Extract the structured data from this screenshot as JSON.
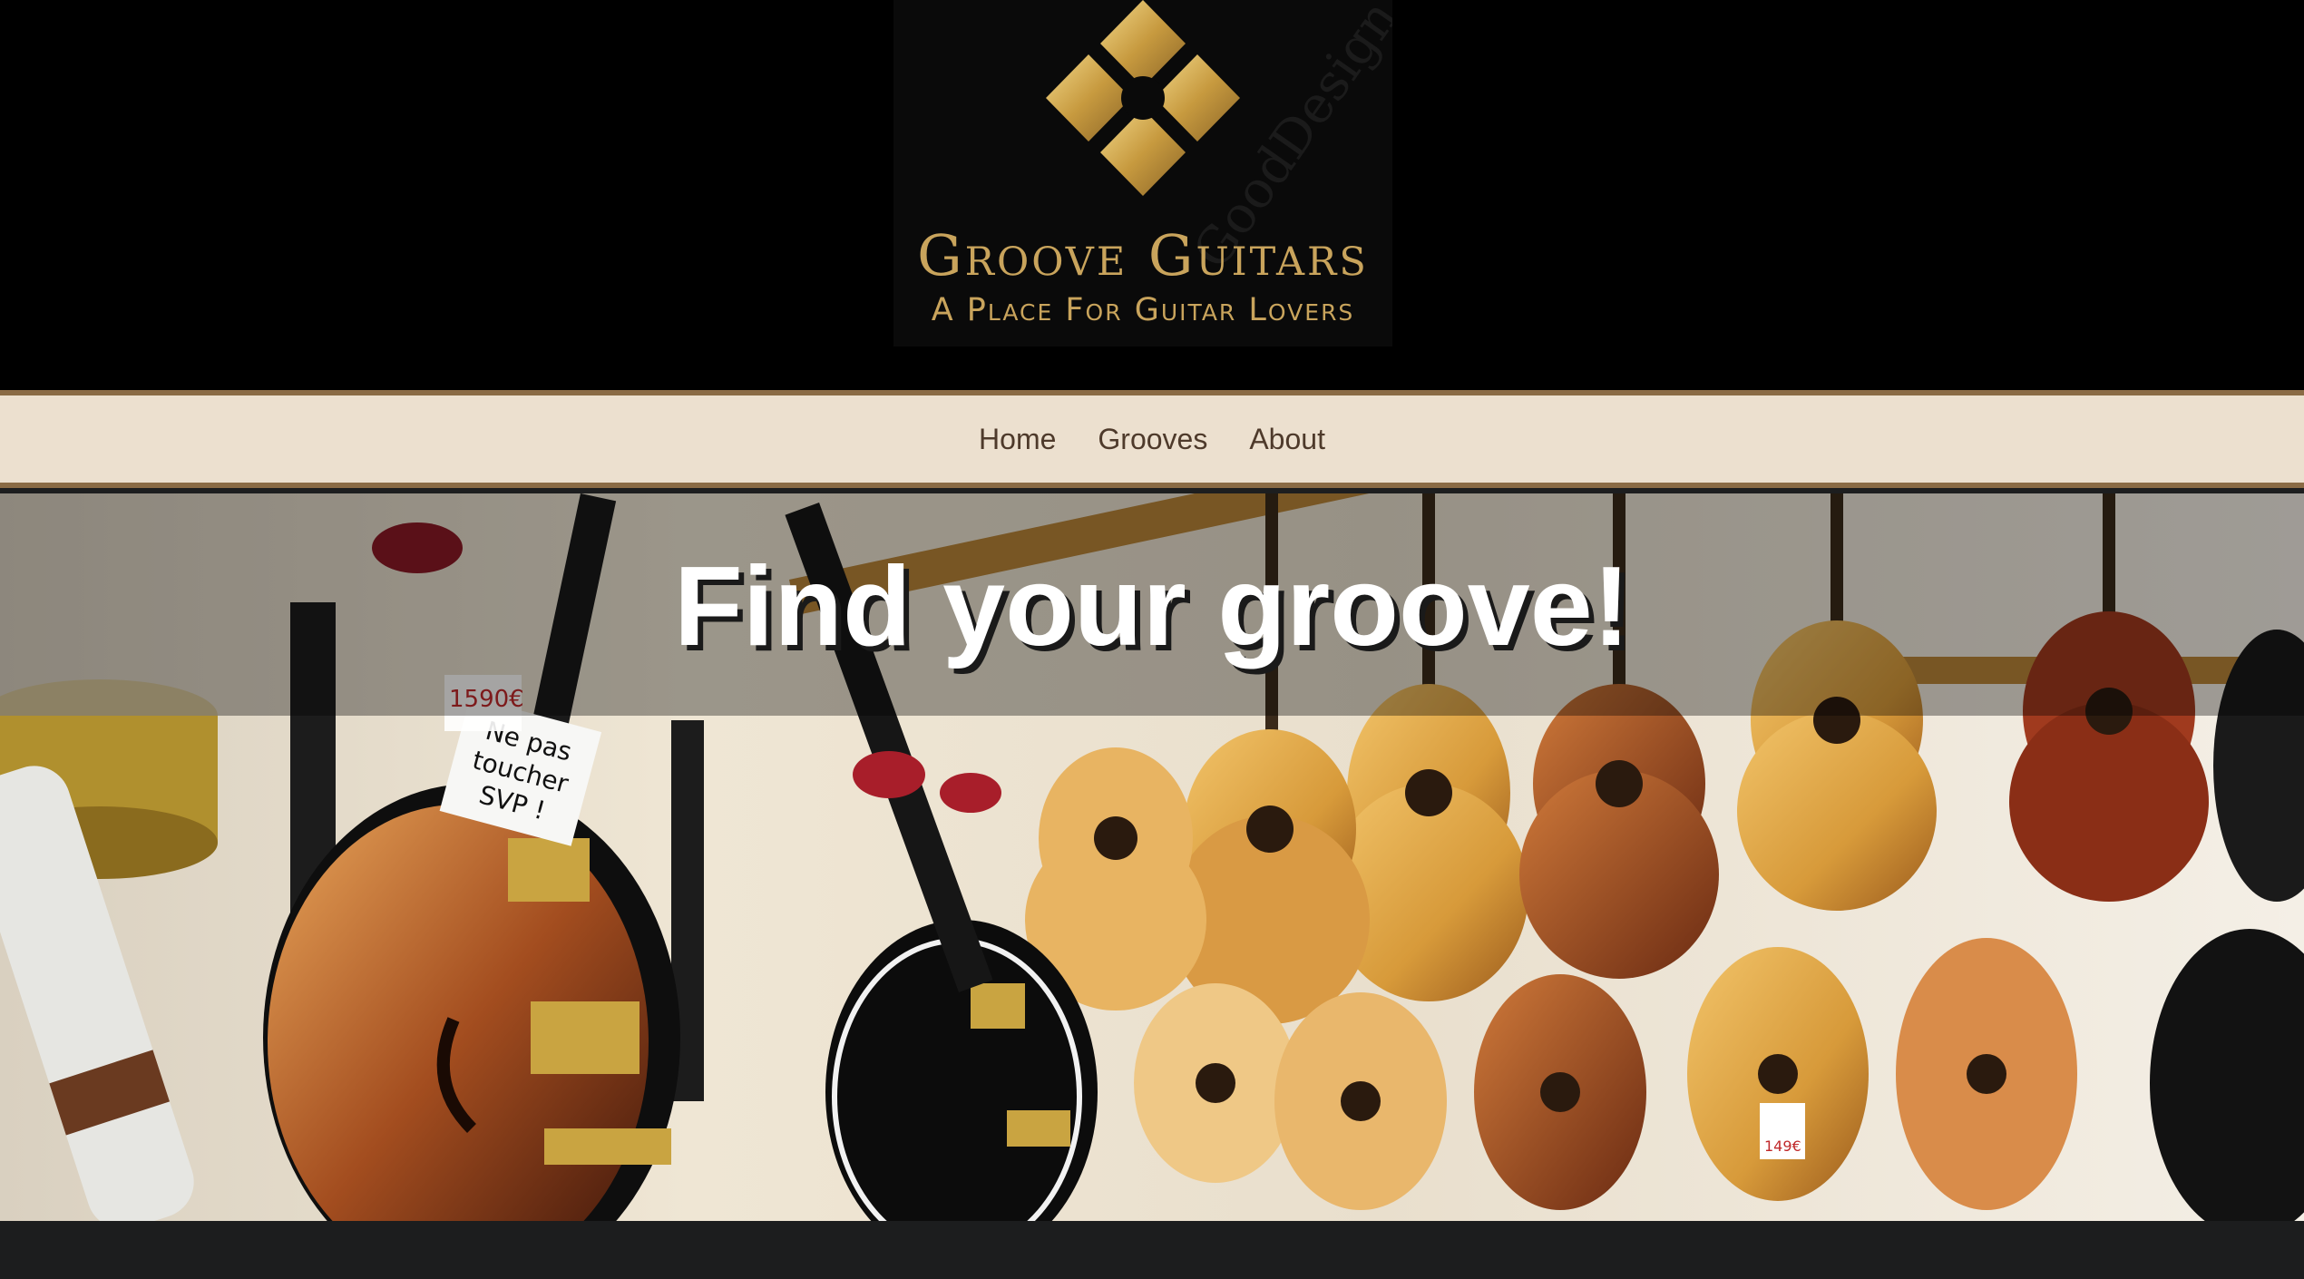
{
  "header": {
    "logo": {
      "title": "Groove Guitars",
      "tagline": "A Place For Guitar Lovers",
      "watermark": "GoodDesign",
      "icon": "diamond-flower-icon",
      "color": "#c9a45c"
    }
  },
  "nav": {
    "items": [
      {
        "label": "Home"
      },
      {
        "label": "Grooves"
      },
      {
        "label": "About"
      }
    ],
    "background": "#ece0cf",
    "border_color": "#8a6b45"
  },
  "hero": {
    "title": "Find your groove!",
    "image": "guitar-shop-photo",
    "sign_text": "Ne pas toucher SVP !",
    "price_tags": [
      "1590€",
      "149€"
    ]
  }
}
